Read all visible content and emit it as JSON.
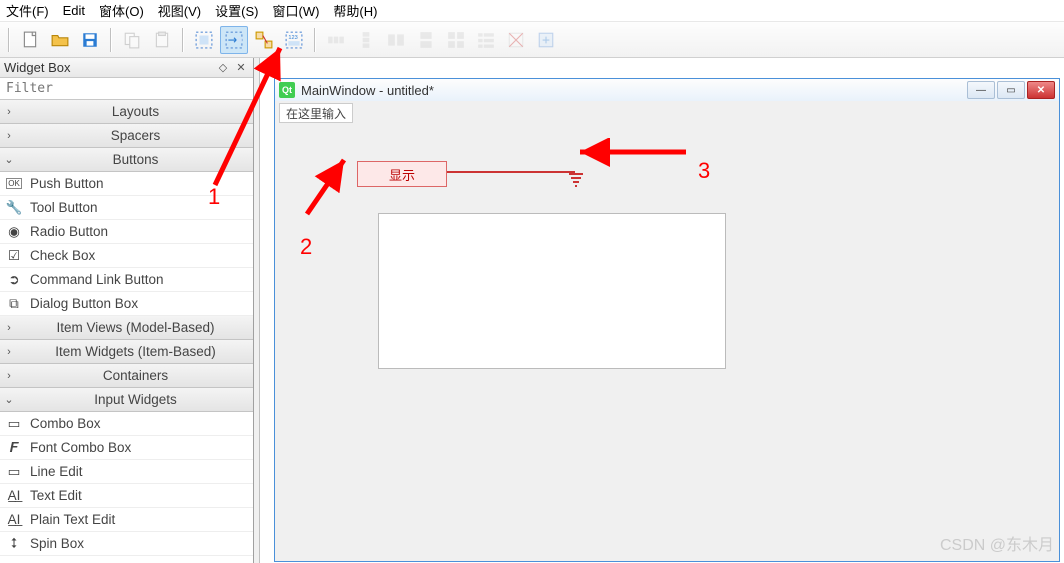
{
  "menu": {
    "file": "文件(F)",
    "edit": "Edit",
    "windowO": "窗体(O)",
    "view": "视图(V)",
    "settings": "设置(S)",
    "windowW": "窗口(W)",
    "help": "帮助(H)"
  },
  "toolbar": {
    "icons": [
      "new-file",
      "open-file",
      "save-file",
      "|",
      "copy",
      "paste",
      "|",
      "select-mode",
      "signal-slot-mode",
      "buddy-mode",
      "tab-order-mode",
      "|",
      "hlayout",
      "vlayout",
      "hsplit",
      "vsplit",
      "grid",
      "form",
      "break",
      "adjust"
    ]
  },
  "panel": {
    "title": "Widget Box",
    "filter_placeholder": "Filter",
    "cats": [
      {
        "label": "Layouts",
        "open": false,
        "chev": ">"
      },
      {
        "label": "Spacers",
        "open": false,
        "chev": ">"
      },
      {
        "label": "Buttons",
        "open": true,
        "chev": "v",
        "items": [
          {
            "label": "Push Button",
            "icon": "OK"
          },
          {
            "label": "Tool Button",
            "icon": "wrench"
          },
          {
            "label": "Radio Button",
            "icon": "radio"
          },
          {
            "label": "Check Box",
            "icon": "check"
          },
          {
            "label": "Command Link Button",
            "icon": "cmd"
          },
          {
            "label": "Dialog Button Box",
            "icon": "dlg"
          }
        ]
      },
      {
        "label": "Item Views (Model-Based)",
        "open": false,
        "chev": ">"
      },
      {
        "label": "Item Widgets (Item-Based)",
        "open": false,
        "chev": ">"
      },
      {
        "label": "Containers",
        "open": false,
        "chev": ">"
      },
      {
        "label": "Input Widgets",
        "open": true,
        "chev": "v",
        "items": [
          {
            "label": "Combo Box",
            "icon": "combo"
          },
          {
            "label": "Font Combo Box",
            "icon": "fcombo"
          },
          {
            "label": "Line Edit",
            "icon": "line"
          },
          {
            "label": "Text Edit",
            "icon": "text"
          },
          {
            "label": "Plain Text Edit",
            "icon": "ptext"
          },
          {
            "label": "Spin Box",
            "icon": "spin"
          }
        ]
      }
    ]
  },
  "mdi": {
    "title": "MainWindow - untitled*",
    "menuinput": "在这里输入"
  },
  "form": {
    "button_label": "显示"
  },
  "annotations": {
    "a1": "1",
    "a2": "2",
    "a3": "3"
  },
  "watermark": "CSDN @东木月"
}
